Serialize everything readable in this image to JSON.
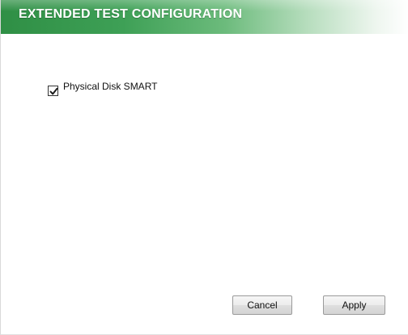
{
  "header": {
    "title": "EXTENDED TEST CONFIGURATION"
  },
  "options": [
    {
      "label": "Physical Disk SMART",
      "checked": true
    }
  ],
  "buttons": {
    "cancel_label": "Cancel",
    "apply_label": "Apply"
  },
  "colors": {
    "header_green": "#3ea056",
    "text": "#111111"
  },
  "icons": {
    "checkmark": "checkmark-icon"
  }
}
